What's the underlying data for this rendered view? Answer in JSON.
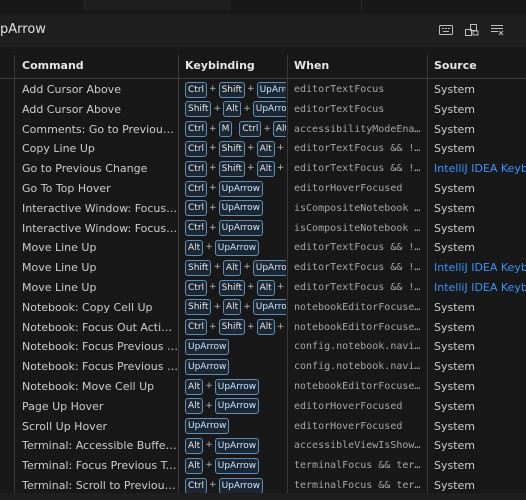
{
  "search": {
    "value": "pArrow"
  },
  "columns": {
    "command": "Command",
    "keybinding": "Keybinding",
    "when": "When",
    "source": "Source"
  },
  "rows": [
    {
      "command": "Add Cursor Above",
      "keys": [
        [
          "Ctrl",
          "Shift",
          "UpArrow"
        ]
      ],
      "when": "editorTextFocus",
      "source": "System",
      "sourceExt": false
    },
    {
      "command": "Add Cursor Above",
      "keys": [
        [
          "Shift",
          "Alt",
          "UpArrow"
        ]
      ],
      "when": "editorTextFocus",
      "source": "System",
      "sourceExt": false
    },
    {
      "command": "Comments: Go to Previous Co...",
      "keys": [
        [
          "Ctrl",
          "M"
        ],
        [
          "Ctrl",
          "Alt"
        ]
      ],
      "when": "accessibilityModeEnable...",
      "source": "System",
      "sourceExt": false
    },
    {
      "command": "Copy Line Up",
      "keys": [
        [
          "Ctrl",
          "Shift",
          "Alt",
          "UpArrow"
        ]
      ],
      "when": "editorTextFocus && !edi...",
      "source": "System",
      "sourceExt": false
    },
    {
      "command": "Go to Previous Change",
      "keys": [
        [
          "Ctrl",
          "Shift",
          "Alt",
          "UpArrow"
        ]
      ],
      "when": "editorTextFocus && !tex...",
      "source": "IntelliJ IDEA Keybindings",
      "sourceExt": true
    },
    {
      "command": "Go To Top Hover",
      "keys": [
        [
          "Ctrl",
          "UpArrow"
        ]
      ],
      "when": "editorHoverFocused",
      "source": "System",
      "sourceExt": false
    },
    {
      "command": "Interactive Window: Focus His...",
      "keys": [
        [
          "Ctrl",
          "UpArrow"
        ]
      ],
      "when": "isCompositeNotebook && ...",
      "source": "System",
      "sourceExt": false
    },
    {
      "command": "Interactive Window: Focus His...",
      "keys": [
        [
          "Ctrl",
          "UpArrow"
        ]
      ],
      "when": "isCompositeNotebook && ...",
      "source": "System",
      "sourceExt": false
    },
    {
      "command": "Move Line Up",
      "keys": [
        [
          "Alt",
          "UpArrow"
        ]
      ],
      "when": "editorTextFocus && !edi...",
      "source": "System",
      "sourceExt": false
    },
    {
      "command": "Move Line Up",
      "keys": [
        [
          "Shift",
          "Alt",
          "UpArrow"
        ]
      ],
      "when": "editorTextFocus && !edi...",
      "source": "IntelliJ IDEA Keybindings",
      "sourceExt": true
    },
    {
      "command": "Move Line Up",
      "keys": [
        [
          "Ctrl",
          "Shift",
          "Alt",
          "UpArrow"
        ]
      ],
      "when": "editorTextFocus && !edi...",
      "source": "IntelliJ IDEA Keybindings",
      "sourceExt": true
    },
    {
      "command": "Notebook: Copy Cell Up",
      "keys": [
        [
          "Shift",
          "Alt",
          "UpArrow"
        ]
      ],
      "when": "notebookEditorFocused &...",
      "source": "System",
      "sourceExt": false
    },
    {
      "command": "Notebook: Focus Out Active C...",
      "keys": [
        [
          "Ctrl",
          "Shift",
          "Alt",
          "UpArrow"
        ]
      ],
      "when": "notebookEditorFocused &...",
      "source": "System",
      "sourceExt": false
    },
    {
      "command": "Notebook: Focus Previous Cel...",
      "keys": [
        [
          "UpArrow"
        ]
      ],
      "when": "config.notebook.navigat...",
      "source": "System",
      "sourceExt": false
    },
    {
      "command": "Notebook: Focus Previous Cel...",
      "keys": [
        [
          "UpArrow"
        ]
      ],
      "when": "config.notebook.navigat...",
      "source": "System",
      "sourceExt": false
    },
    {
      "command": "Notebook: Move Cell Up",
      "keys": [
        [
          "Alt",
          "UpArrow"
        ]
      ],
      "when": "notebookEditorFocused &...",
      "source": "System",
      "sourceExt": false
    },
    {
      "command": "Page Up Hover",
      "keys": [
        [
          "Alt",
          "UpArrow"
        ]
      ],
      "when": "editorHoverFocused",
      "source": "System",
      "sourceExt": false
    },
    {
      "command": "Scroll Up Hover",
      "keys": [
        [
          "UpArrow"
        ]
      ],
      "when": "editorHoverFocused",
      "source": "System",
      "sourceExt": false
    },
    {
      "command": "Terminal: Accessible Buffer G...",
      "keys": [
        [
          "Alt",
          "UpArrow"
        ]
      ],
      "when": "accessibleViewIsShown &...",
      "source": "System",
      "sourceExt": false
    },
    {
      "command": "Terminal: Focus Previous Ter...",
      "keys": [
        [
          "Alt",
          "UpArrow"
        ]
      ],
      "when": "terminalFocus && termin...",
      "source": "System",
      "sourceExt": false
    },
    {
      "command": "Terminal: Scroll to Previous C...",
      "keys": [
        [
          "Ctrl",
          "UpArrow"
        ]
      ],
      "when": "terminalFocus && termin...",
      "source": "System",
      "sourceExt": false
    }
  ],
  "icons": {
    "recordKeys": "keyboard-icon",
    "sortByPrecedence": "sort-precedence-icon",
    "clear": "clear-filter-icon"
  },
  "colors": {
    "accent": "#3794ff",
    "keycapBorder": "#5d8fb6"
  }
}
